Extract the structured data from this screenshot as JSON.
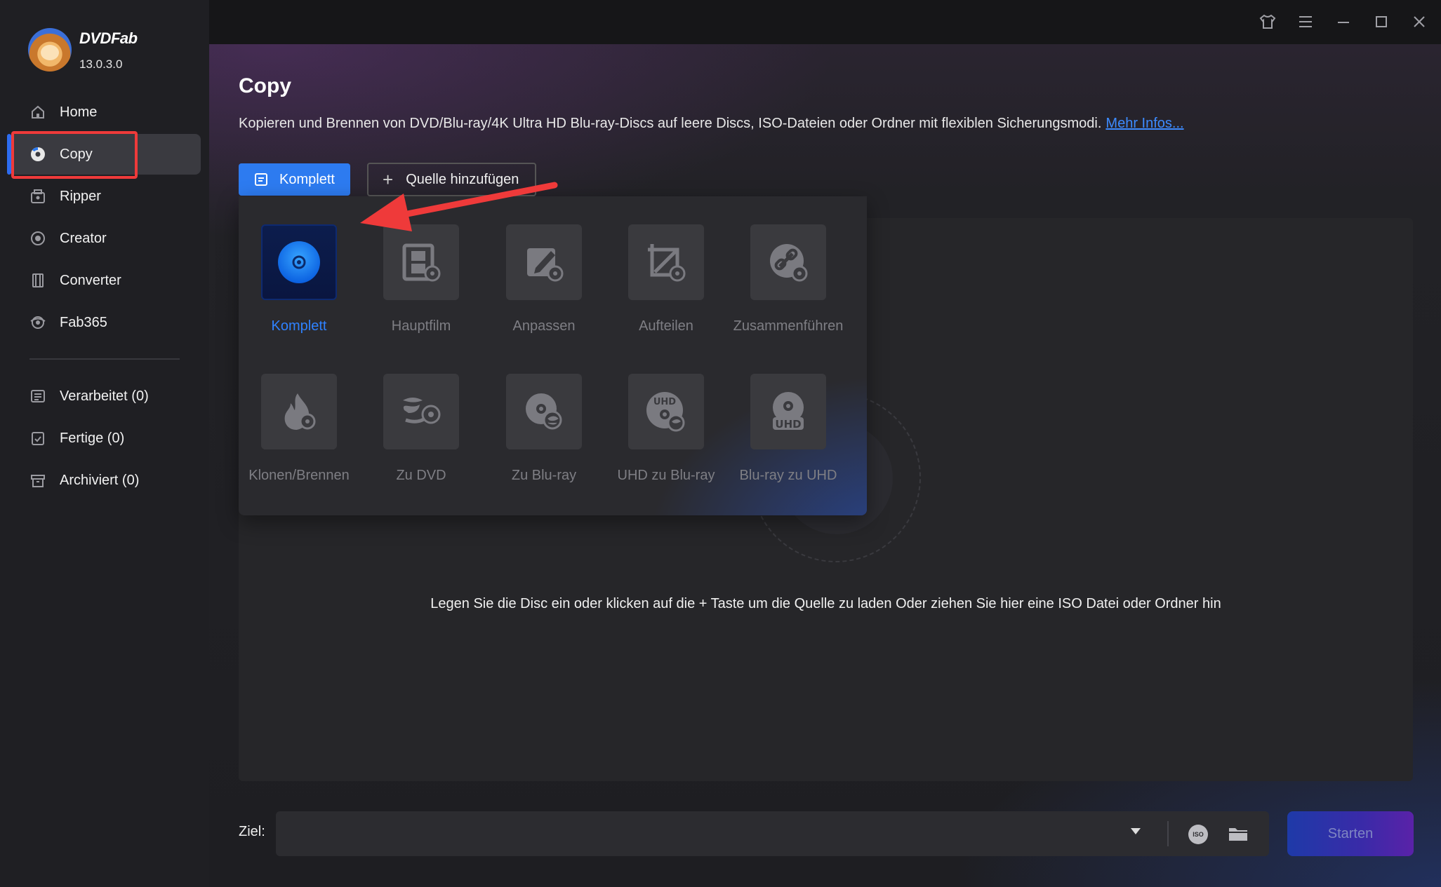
{
  "app": {
    "brand": "DVDFab",
    "version": "13.0.3.0"
  },
  "sidebar": {
    "items": [
      {
        "label": "Home",
        "icon": "home-icon"
      },
      {
        "label": "Copy",
        "icon": "copy-disc-icon"
      },
      {
        "label": "Ripper",
        "icon": "ripper-icon"
      },
      {
        "label": "Creator",
        "icon": "creator-icon"
      },
      {
        "label": "Converter",
        "icon": "converter-icon"
      },
      {
        "label": "Fab365",
        "icon": "fab365-icon"
      }
    ],
    "queue": [
      {
        "label": "Verarbeitet (0)",
        "icon": "list-icon"
      },
      {
        "label": "Fertige (0)",
        "icon": "clipboard-check-icon"
      },
      {
        "label": "Archiviert (0)",
        "icon": "archive-icon"
      }
    ]
  },
  "page": {
    "title": "Copy",
    "description": "Kopieren und Brennen von DVD/Blu-ray/4K Ultra HD Blu-ray-Discs auf leere Discs, ISO-Dateien oder Ordner mit flexiblen Sicherungsmodi.",
    "more_link": "Mehr Infos...",
    "mode_button": "Komplett",
    "add_source_button": "Quelle hinzufügen",
    "drop_hint": "Legen Sie die Disc ein oder klicken auf die + Taste um die Quelle zu laden Oder ziehen Sie hier eine ISO Datei oder Ordner hin"
  },
  "modes": [
    {
      "label": "Komplett",
      "icon": "disc-icon",
      "active": true
    },
    {
      "label": "Hauptfilm",
      "icon": "film-disc-icon"
    },
    {
      "label": "Anpassen",
      "icon": "edit-disc-icon"
    },
    {
      "label": "Aufteilen",
      "icon": "split-disc-icon"
    },
    {
      "label": "Zusammenführen",
      "icon": "merge-link-icon"
    },
    {
      "label": "Klonen/Brennen",
      "icon": "flame-disc-icon"
    },
    {
      "label": "Zu DVD",
      "icon": "bluray-to-dvd-icon"
    },
    {
      "label": "Zu Blu-ray",
      "icon": "disc-to-bluray-icon"
    },
    {
      "label": "UHD zu Blu-ray",
      "icon": "uhd-to-bluray-icon",
      "badge": "UHD"
    },
    {
      "label": "Blu-ray zu UHD",
      "icon": "bluray-to-uhd-icon",
      "badge": "UHD"
    }
  ],
  "bottom": {
    "target_label": "Ziel:",
    "iso_badge": "ISO",
    "start_button": "Starten"
  },
  "colors": {
    "accent": "#2d7bf0",
    "highlight": "#ef3a3a"
  }
}
